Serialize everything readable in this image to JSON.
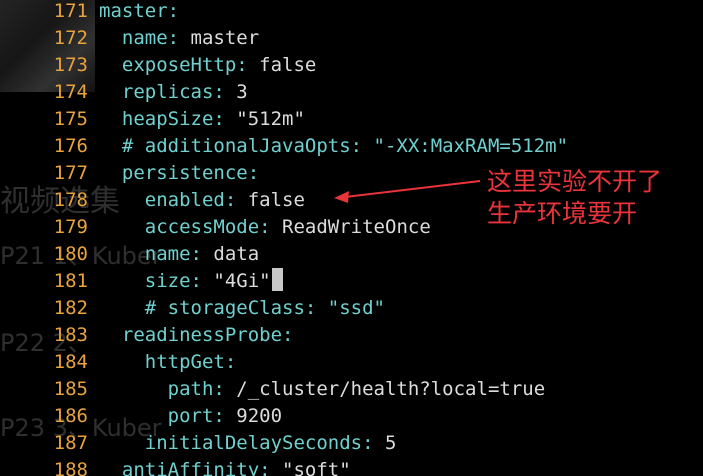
{
  "editor": {
    "lines": [
      {
        "num": "171",
        "indent": "",
        "key": "master:",
        "value": ""
      },
      {
        "num": "172",
        "indent": "  ",
        "key": "name:",
        "value": " master"
      },
      {
        "num": "173",
        "indent": "  ",
        "key": "exposeHttp:",
        "value": " false"
      },
      {
        "num": "174",
        "indent": "  ",
        "key": "replicas:",
        "value": " 3"
      },
      {
        "num": "175",
        "indent": "  ",
        "key": "heapSize:",
        "value": " \"512m\""
      },
      {
        "num": "176",
        "indent": "  ",
        "comment": "# additionalJavaOpts: \"-XX:MaxRAM=512m\""
      },
      {
        "num": "177",
        "indent": "  ",
        "key": "persistence:",
        "value": ""
      },
      {
        "num": "178",
        "indent": "    ",
        "key": "enabled:",
        "value": " false"
      },
      {
        "num": "179",
        "indent": "    ",
        "key": "accessMode:",
        "value": " ReadWriteOnce"
      },
      {
        "num": "180",
        "indent": "    ",
        "key": "name:",
        "value": " data"
      },
      {
        "num": "181",
        "indent": "    ",
        "key": "size:",
        "value": " \"4Gi\"",
        "cursor": true
      },
      {
        "num": "182",
        "indent": "    ",
        "comment": "# storageClass: \"ssd\""
      },
      {
        "num": "183",
        "indent": "  ",
        "key": "readinessProbe:",
        "value": ""
      },
      {
        "num": "184",
        "indent": "    ",
        "key": "httpGet:",
        "value": ""
      },
      {
        "num": "185",
        "indent": "      ",
        "key": "path:",
        "value": " /_cluster/health?local=true"
      },
      {
        "num": "186",
        "indent": "      ",
        "key": "port:",
        "value": " 9200"
      },
      {
        "num": "187",
        "indent": "    ",
        "key": "initialDelaySeconds:",
        "value": " 5"
      },
      {
        "num": "188",
        "indent": "  ",
        "key": "antiAffinity:",
        "value": " \"soft\""
      }
    ]
  },
  "background": {
    "heading": "视频选集",
    "items": [
      "P21  1、Kuber",
      "P22  2、",
      "P23  3、Kuber"
    ]
  },
  "annotation": {
    "line1": "这里实验不开了",
    "line2": "生产环境要开",
    "color": "#e8343a"
  },
  "colors": {
    "background": "#000000",
    "line_number": "#e8a33c",
    "key": "#6fd1cf",
    "value": "#dcdcdc"
  }
}
